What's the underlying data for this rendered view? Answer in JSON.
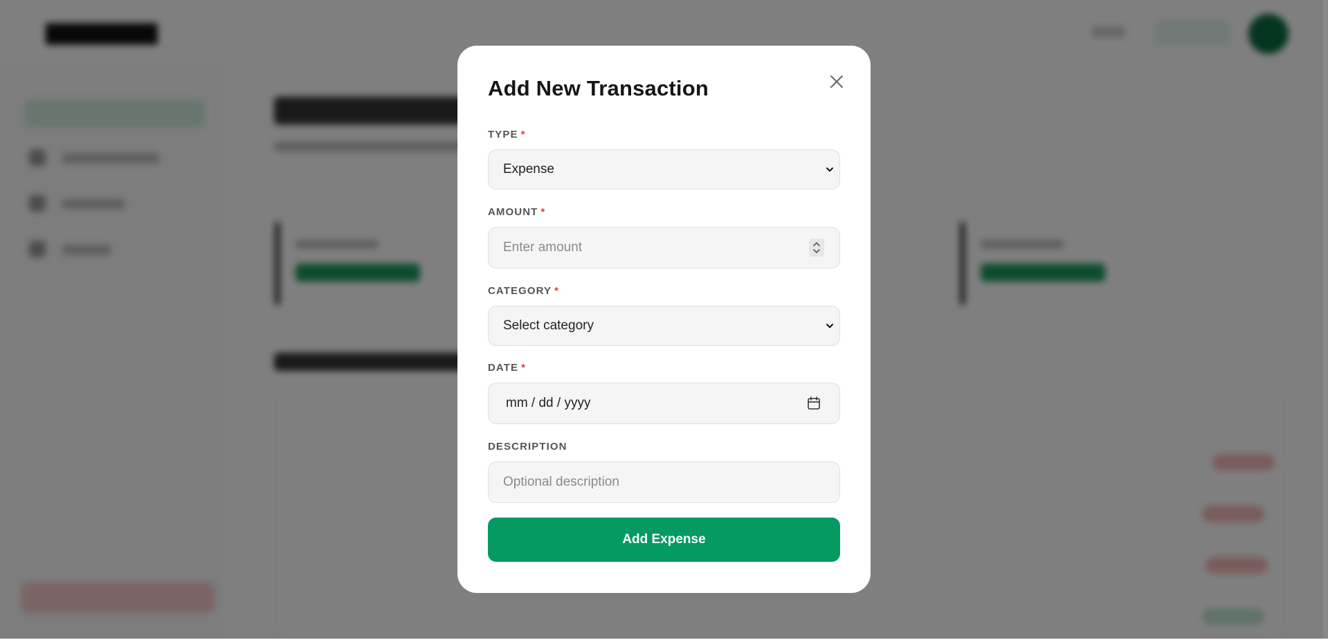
{
  "modal": {
    "title": "Add New Transaction",
    "close_icon": "close-icon",
    "required_marker": "*",
    "type": {
      "label": "TYPE",
      "selected": "Expense",
      "icon": "chevron-down-icon"
    },
    "amount": {
      "label": "AMOUNT",
      "placeholder": "Enter amount",
      "icon": "spinner-icon"
    },
    "category": {
      "label": "CATEGORY",
      "selected": "Select category",
      "icon": "chevron-down-icon"
    },
    "date": {
      "label": "DATE",
      "value": "mm / dd / yyyy",
      "icon": "calendar-icon"
    },
    "description": {
      "label": "DESCRIPTION",
      "placeholder": "Optional description"
    },
    "submit_label": "Add Expense"
  },
  "colors": {
    "accent": "#049a62",
    "required": "#e03b3b",
    "overlay": "rgba(0,0,0,0.5)"
  }
}
